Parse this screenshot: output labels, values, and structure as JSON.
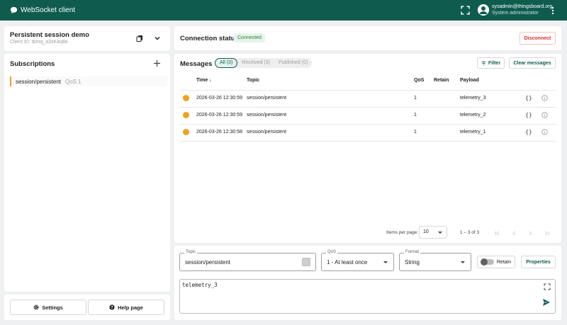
{
  "app": {
    "title": "WebSocket client"
  },
  "user": {
    "email": "sysadmin@thingsboard.org",
    "role": "System administrator"
  },
  "connection": {
    "name": "Persistent session demo",
    "client_id": "Client ID: tbmq_a3sK4q8e"
  },
  "subscriptions": {
    "title": "Subscriptions",
    "items": [
      {
        "topic": "session/persistent",
        "qos": "QoS 1",
        "color": "#f0a020"
      }
    ]
  },
  "left_footer": {
    "settings_label": "Settings",
    "help_label": "Help page"
  },
  "status": {
    "label": "Connection status",
    "badge": "Connected",
    "disconnect_label": "Disconnect"
  },
  "messages": {
    "title": "Messages",
    "tabs": [
      {
        "label": "All (3)"
      },
      {
        "label": "Received (3)"
      },
      {
        "label": "Published (0)"
      }
    ],
    "filter_label": "Filter",
    "clear_label": "Clear messages",
    "columns": {
      "time": "Time",
      "topic": "Topic",
      "qos": "QoS",
      "retain": "Retain",
      "payload": "Payload"
    },
    "rows": [
      {
        "time": "2026-03-26 12:30:59",
        "topic": "session/persistent",
        "qos": "1",
        "retain": "",
        "payload": "telemetry_3"
      },
      {
        "time": "2026-03-26 12:30:59",
        "topic": "session/persistent",
        "qos": "1",
        "retain": "",
        "payload": "telemetry_2"
      },
      {
        "time": "2026-03-26 12:30:58",
        "topic": "session/persistent",
        "qos": "1",
        "retain": "",
        "payload": "telemetry_1"
      }
    ],
    "json_label": "{}",
    "pager": {
      "items_per_page_label": "Items per page:",
      "items_per_page": "10",
      "range": "1 – 3 of 3"
    }
  },
  "compose": {
    "topic_label": "Topic",
    "topic_value": "session/persistent",
    "qos_label": "QoS",
    "qos_value": "1 - At least once",
    "format_label": "Format",
    "format_value": "String",
    "retain_label": "Retain",
    "properties_label": "Properties",
    "payload_value": "telemetry_3"
  },
  "colors": {
    "primary": "#0f5c4e",
    "accent": "#f0a020",
    "danger": "#d32f2f",
    "success": "#2e7d32"
  }
}
